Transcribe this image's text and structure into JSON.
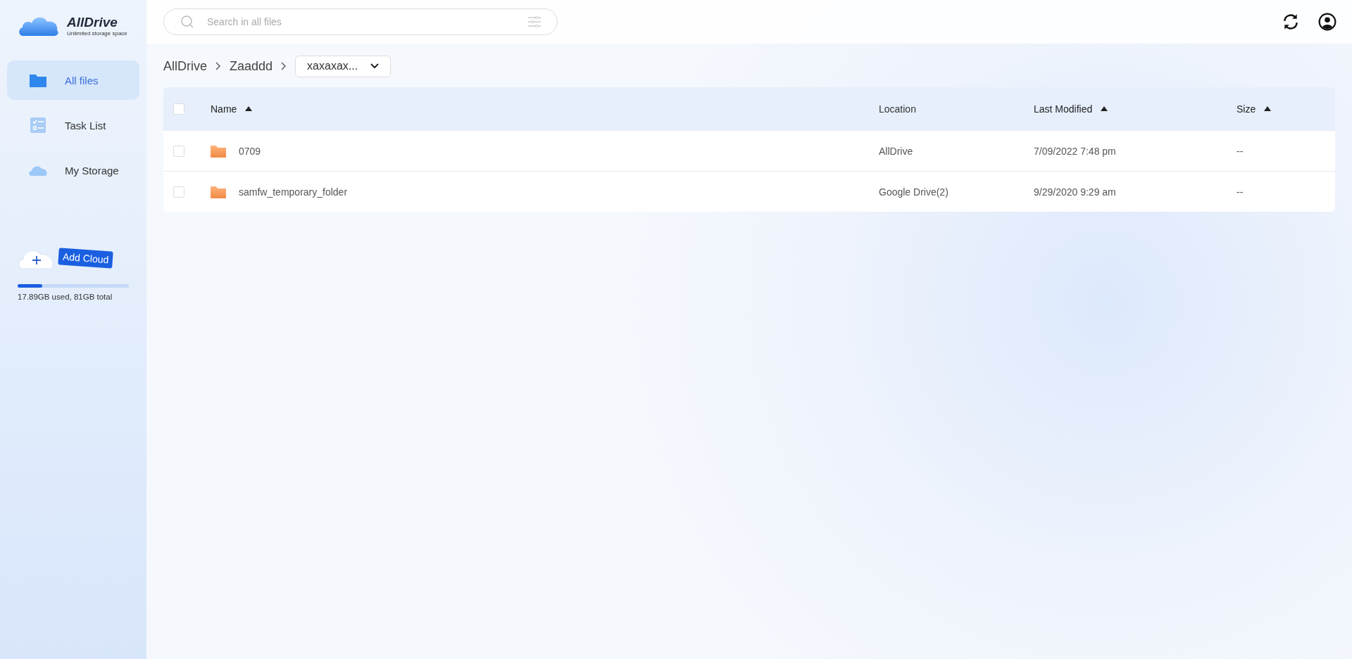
{
  "app": {
    "name": "AllDrive",
    "tagline": "Unlimited storage space"
  },
  "sidebar": {
    "items": [
      {
        "label": "All files",
        "kind": "folder",
        "selected": true
      },
      {
        "label": "Task List",
        "kind": "tasks",
        "selected": false
      },
      {
        "label": "My Storage",
        "kind": "cloud",
        "selected": false
      }
    ],
    "add_cloud": "Add Cloud",
    "storage": {
      "level": 0.22,
      "text": "17.89GB used, 81GB total"
    }
  },
  "search": {
    "placeholder": "Search in all files"
  },
  "breadcrumb": {
    "items": [
      "AllDrive",
      "Zaaddd"
    ],
    "current": "xaxaxax..."
  },
  "table": {
    "columns": [
      {
        "label": "Name",
        "sorted": true
      },
      {
        "label": "Location",
        "sorted": false
      },
      {
        "label": "Last Modified",
        "sorted": true
      },
      {
        "label": "Size",
        "sorted": true
      }
    ],
    "all_checked": false,
    "rows": [
      {
        "checked": false,
        "name": "0709",
        "location": "AllDrive",
        "modified": "7/09/2022 7:48 pm",
        "size": "--"
      },
      {
        "checked": false,
        "name": "samfw_temporary_folder",
        "location": "Google Drive(2)",
        "modified": "9/29/2020 9:29 am",
        "size": "--"
      }
    ]
  }
}
